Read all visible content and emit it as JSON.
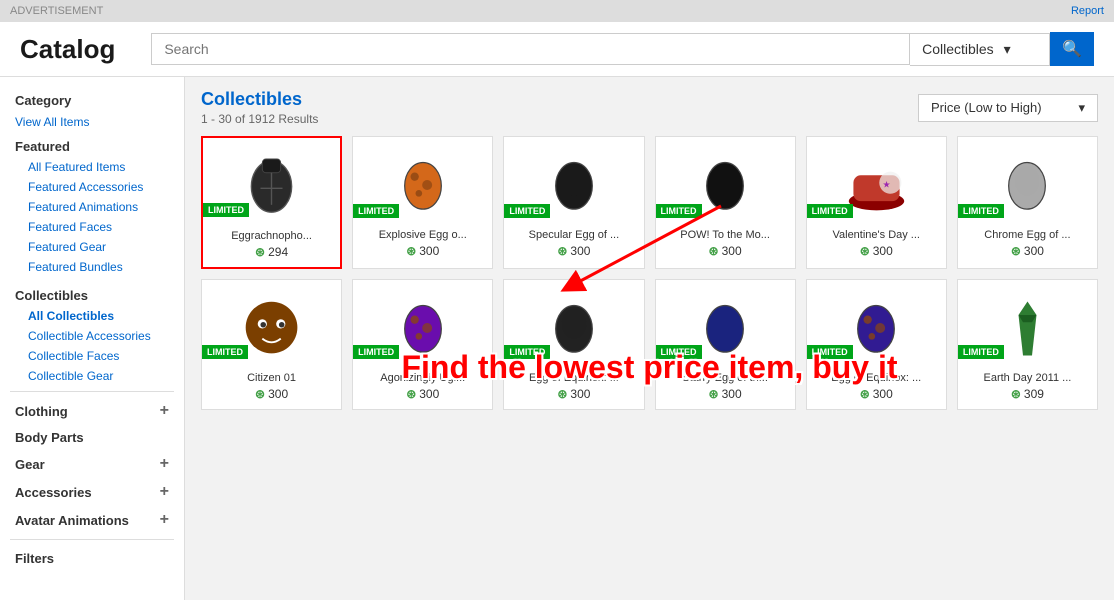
{
  "topbar": {
    "advertisement": "ADVERTISEMENT",
    "report": "Report"
  },
  "header": {
    "title": "Catalog",
    "search_placeholder": "Search",
    "category_dropdown": "Collectibles",
    "search_icon": "🔍"
  },
  "sidebar": {
    "category_label": "Category",
    "view_all": "View All Items",
    "featured_label": "Featured",
    "featured_links": [
      "All Featured Items",
      "Featured Accessories",
      "Featured Animations",
      "Featured Faces",
      "Featured Gear",
      "Featured Bundles"
    ],
    "collectibles_label": "Collectibles",
    "collectibles_links": [
      "All Collectibles",
      "Collectible Accessories",
      "Collectible Faces",
      "Collectible Gear"
    ],
    "clothing_label": "Clothing",
    "body_parts_label": "Body Parts",
    "gear_label": "Gear",
    "accessories_label": "Accessories",
    "avatar_animations_label": "Avatar Animations",
    "filters_label": "Filters"
  },
  "content": {
    "title": "Collectibles",
    "results": "1 - 30 of 1912 Results",
    "sort_label": "Price (Low to High)",
    "items": [
      {
        "name": "Eggrachnopho...",
        "price": "294",
        "badge": "LIMITED",
        "color": "#2a2a2a",
        "shape": "backpack",
        "highlighted": true
      },
      {
        "name": "Explosive Egg o...",
        "price": "300",
        "badge": "LIMITED",
        "color": "#d4681a",
        "shape": "egg"
      },
      {
        "name": "Specular Egg of ...",
        "price": "300",
        "badge": "LIMITED",
        "color": "#1a1a1a",
        "shape": "egg"
      },
      {
        "name": "POW! To the Mo...",
        "price": "300",
        "badge": "LIMITED",
        "color": "#111",
        "shape": "egg"
      },
      {
        "name": "Valentine's Day ...",
        "price": "300",
        "badge": "LIMITED",
        "color": "#c0392b",
        "shape": "hat"
      },
      {
        "name": "Chrome Egg of ...",
        "price": "300",
        "badge": "LIMITED",
        "color": "#aaa",
        "shape": "egg"
      },
      {
        "name": "Citizen 01",
        "price": "300",
        "badge": "LIMITED",
        "color": "#7b3f00",
        "shape": "face"
      },
      {
        "name": "Agonizingly Ugl...",
        "price": "300",
        "badge": "LIMITED",
        "color": "#6a0dad",
        "shape": "egg"
      },
      {
        "name": "Egg of Equinox: ...",
        "price": "300",
        "badge": "LIMITED",
        "color": "#222",
        "shape": "egg"
      },
      {
        "name": "Starry Egg of th...",
        "price": "300",
        "badge": "LIMITED",
        "color": "#1a237e",
        "shape": "egg"
      },
      {
        "name": "Egg of Equinox: ...",
        "price": "300",
        "badge": "LIMITED",
        "color": "#311b92",
        "shape": "egg"
      },
      {
        "name": "Earth Day 2011 ...",
        "price": "309",
        "badge": "LIMITED",
        "color": "#2e7d32",
        "shape": "tie"
      }
    ],
    "overlay_text": "Find the lowest price item, buy it"
  },
  "colors": {
    "limited_badge": "#00a519",
    "link_color": "#0066cc",
    "highlight_border": "red",
    "overlay_text": "red"
  }
}
